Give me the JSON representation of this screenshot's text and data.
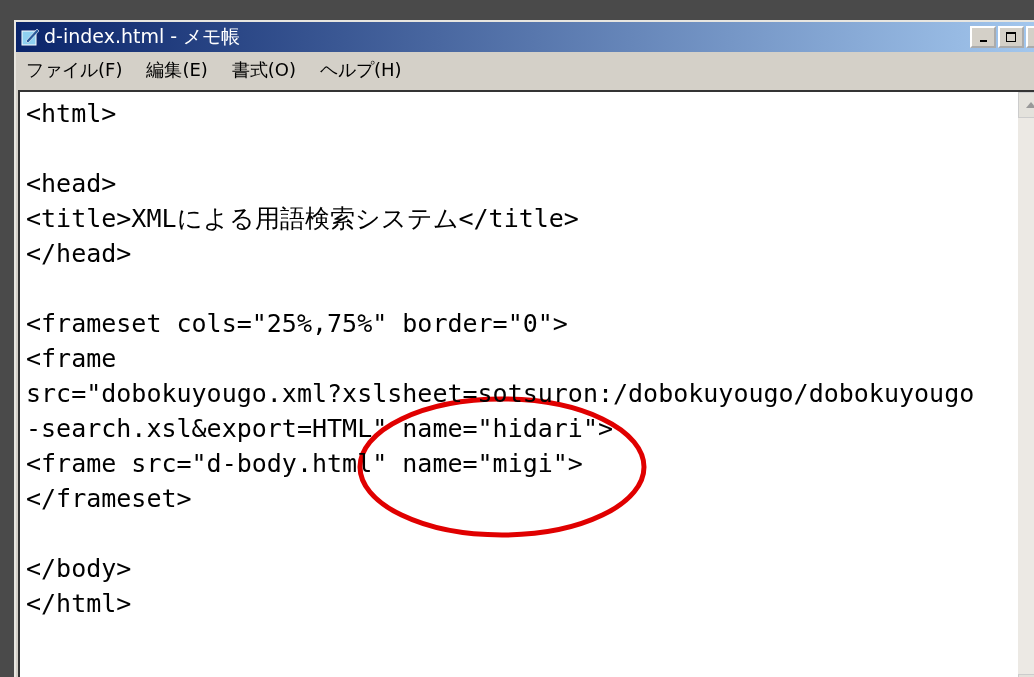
{
  "window": {
    "title": "d-index.html - メモ帳"
  },
  "menu": [
    "ファイル(F)",
    "編集(E)",
    "書式(O)",
    "ヘルプ(H)"
  ],
  "editor": {
    "lines": [
      {
        "kind": "code",
        "text": "<html>"
      },
      {
        "kind": "blank"
      },
      {
        "kind": "code",
        "text": "<head>"
      },
      {
        "kind": "code",
        "text": "<title>XMLによる用語検索システム</title>"
      },
      {
        "kind": "code",
        "text": "</head>"
      },
      {
        "kind": "blank"
      },
      {
        "kind": "code",
        "text": "<frameset cols=\"25%,75%\" border=\"0\">"
      },
      {
        "kind": "code",
        "text": "<frame"
      },
      {
        "kind": "code",
        "text": "src=\"dobokuyougo.xml?xslsheet=sotsuron:/dobokuyougo/dobokuyougo"
      },
      {
        "kind": "code",
        "text": "-search.xsl&export=HTML\" name=\"hidari\">"
      },
      {
        "kind": "code",
        "text": "<frame src=\"d-body.html\" name=\"migi\">"
      },
      {
        "kind": "code",
        "text": "</frameset>"
      },
      {
        "kind": "blank"
      },
      {
        "kind": "code",
        "text": "</body>"
      },
      {
        "kind": "code",
        "text": "</html>"
      }
    ]
  },
  "annotation": {
    "kind": "ellipse",
    "color": "#e00000"
  }
}
